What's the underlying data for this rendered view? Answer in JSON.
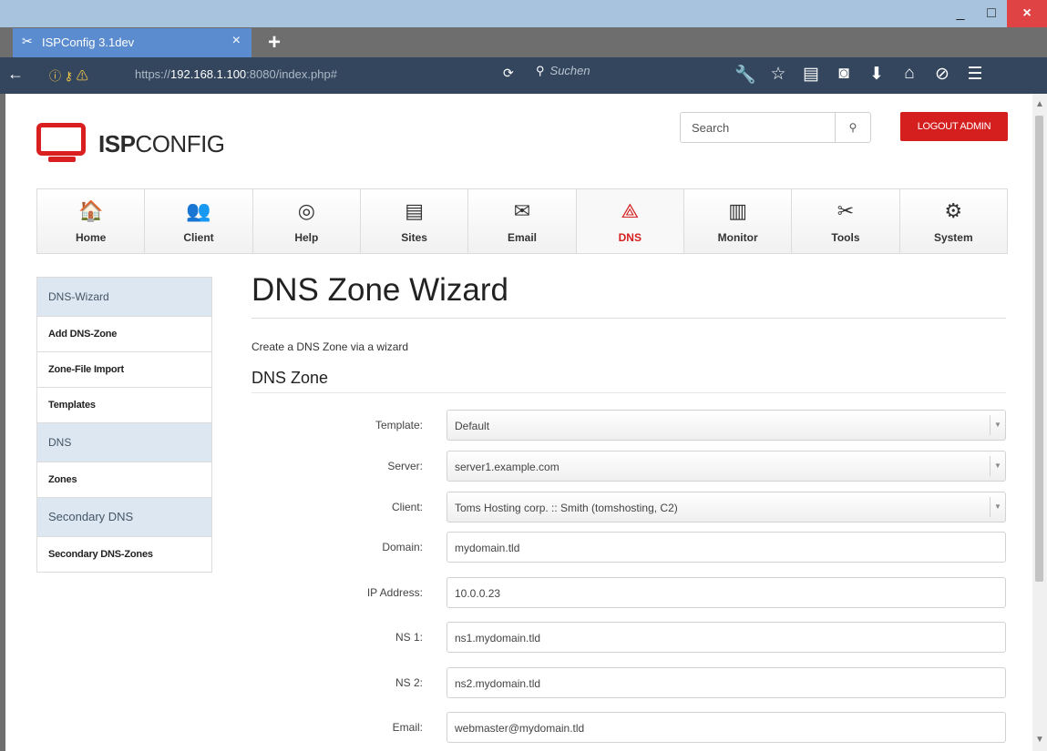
{
  "browser": {
    "tab_title": "ISPConfig 3.1dev",
    "tab_close": "×",
    "new_tab": "+",
    "url_prefix": "https://",
    "url_host": "192.168.1.100",
    "url_rest": ":8080/index.php#",
    "search_placeholder": "Suchen",
    "window_buttons": [
      "_",
      "□",
      "×"
    ]
  },
  "header": {
    "logo_bold": "ISP",
    "logo_light": "CONFIG",
    "search_placeholder": "Search",
    "logout_label": "LOGOUT ADMIN"
  },
  "mainnav": [
    {
      "label": "Home",
      "icon": "home-icon",
      "glyph": "🏠"
    },
    {
      "label": "Client",
      "icon": "users-icon",
      "glyph": "👥"
    },
    {
      "label": "Help",
      "icon": "lifebuoy-icon",
      "glyph": "◎"
    },
    {
      "label": "Sites",
      "icon": "window-icon",
      "glyph": "▤"
    },
    {
      "label": "Email",
      "icon": "envelope-icon",
      "glyph": "✉"
    },
    {
      "label": "DNS",
      "icon": "network-icon",
      "glyph": "⟁"
    },
    {
      "label": "Monitor",
      "icon": "server-icon",
      "glyph": "▥"
    },
    {
      "label": "Tools",
      "icon": "tools-icon",
      "glyph": "✂"
    },
    {
      "label": "System",
      "icon": "gear-icon",
      "glyph": "⚙"
    }
  ],
  "sidebar": {
    "groups": [
      {
        "heading": "DNS-Wizard",
        "items": [
          "Add DNS-Zone",
          "Zone-File Import",
          "Templates"
        ]
      },
      {
        "heading": "DNS",
        "items": [
          "Zones"
        ]
      },
      {
        "heading": "Secondary DNS",
        "items": [
          "Secondary DNS-Zones"
        ]
      }
    ]
  },
  "content": {
    "title": "DNS Zone Wizard",
    "subtitle": "Create a DNS Zone via a wizard",
    "section": "DNS Zone",
    "fields": [
      {
        "label": "Template:",
        "value": "Default",
        "type": "select"
      },
      {
        "label": "Server:",
        "value": "server1.example.com",
        "type": "select"
      },
      {
        "label": "Client:",
        "value": "Toms Hosting corp. :: Smith (tomshosting, C2)",
        "type": "select"
      },
      {
        "label": "Domain:",
        "value": "mydomain.tld",
        "type": "input"
      },
      {
        "label": "IP Address:",
        "value": "10.0.0.23",
        "type": "input"
      },
      {
        "label": "NS 1:",
        "value": "ns1.mydomain.tld",
        "type": "input"
      },
      {
        "label": "NS 2:",
        "value": "ns2.mydomain.tld",
        "type": "input"
      },
      {
        "label": "Email:",
        "value": "webmaster@mydomain.tld",
        "type": "input"
      }
    ]
  },
  "colors": {
    "accent": "#d51f1f",
    "sidebar_heading_bg": "#dde7f1",
    "browser_tab": "#5a8ccf",
    "browser_toolbar": "#33465e"
  }
}
